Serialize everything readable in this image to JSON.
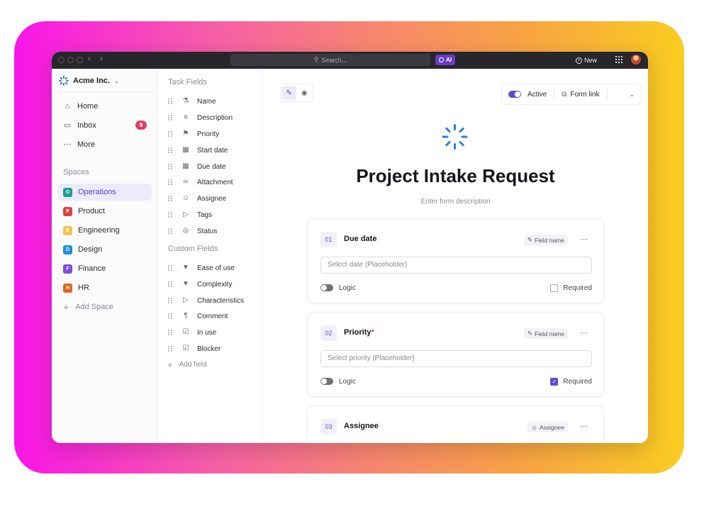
{
  "titlebar": {
    "search_placeholder": "Search...",
    "ai_label": "AI",
    "new_label": "New"
  },
  "sidebar": {
    "workspace_name": "Acme Inc.",
    "nav": [
      {
        "label": "Home",
        "icon": "home-icon"
      },
      {
        "label": "Inbox",
        "icon": "inbox-icon",
        "badge": "9"
      },
      {
        "label": "More",
        "icon": "more-icon"
      }
    ],
    "spaces_label": "Spaces",
    "spaces": [
      {
        "letter": "O",
        "label": "Operations",
        "color": "#1b9e8f",
        "active": true
      },
      {
        "letter": "P",
        "label": "Product",
        "color": "#d8413e"
      },
      {
        "letter": "E",
        "label": "Engineering",
        "color": "#f3c34a"
      },
      {
        "letter": "D",
        "label": "Design",
        "color": "#1d8fe0"
      },
      {
        "letter": "F",
        "label": "Finance",
        "color": "#7c4dd6"
      },
      {
        "letter": "H",
        "label": "HR",
        "color": "#e0661f"
      }
    ],
    "add_space_label": "Add Space"
  },
  "fields": {
    "task_heading": "Task Fields",
    "task_fields": [
      {
        "label": "Name",
        "icon": "name-icon"
      },
      {
        "label": "Description",
        "icon": "description-icon"
      },
      {
        "label": "Priority",
        "icon": "flag-icon"
      },
      {
        "label": "Start date",
        "icon": "calendar-icon"
      },
      {
        "label": "Due date",
        "icon": "calendar-icon"
      },
      {
        "label": "Attachment",
        "icon": "paperclip-icon"
      },
      {
        "label": "Assignee",
        "icon": "user-icon"
      },
      {
        "label": "Tags",
        "icon": "tag-icon"
      },
      {
        "label": "Status",
        "icon": "status-icon"
      }
    ],
    "custom_heading": "Custom Fields",
    "custom_fields": [
      {
        "label": "Ease of use",
        "icon": "dropdown-icon"
      },
      {
        "label": "Complexity",
        "icon": "dropdown-icon"
      },
      {
        "label": "Characteristics",
        "icon": "tag-icon"
      },
      {
        "label": "Comment",
        "icon": "text-icon"
      },
      {
        "label": "In use",
        "icon": "checkbox-icon"
      },
      {
        "label": "Blocker",
        "icon": "checkbox-icon"
      }
    ],
    "add_field_label": "Add field"
  },
  "main": {
    "active_label": "Active",
    "form_link_label": "Form link",
    "form_title": "Project Intake Request",
    "form_description": "Enter form description",
    "cards": [
      {
        "number": "01",
        "title": "Due date",
        "required_star": "",
        "tag": "Field name",
        "placeholder": "Select date (Placeholder)",
        "logic_label": "Logic",
        "required_label": "Required",
        "required": false
      },
      {
        "number": "02",
        "title": "Priority",
        "required_star": "*",
        "tag": "Field name",
        "placeholder": "Select priority (Placeholder)",
        "logic_label": "Logic",
        "required_label": "Required",
        "required": true
      },
      {
        "number": "03",
        "title": "Assignee",
        "required_star": "",
        "tag": "Assignee"
      }
    ]
  }
}
